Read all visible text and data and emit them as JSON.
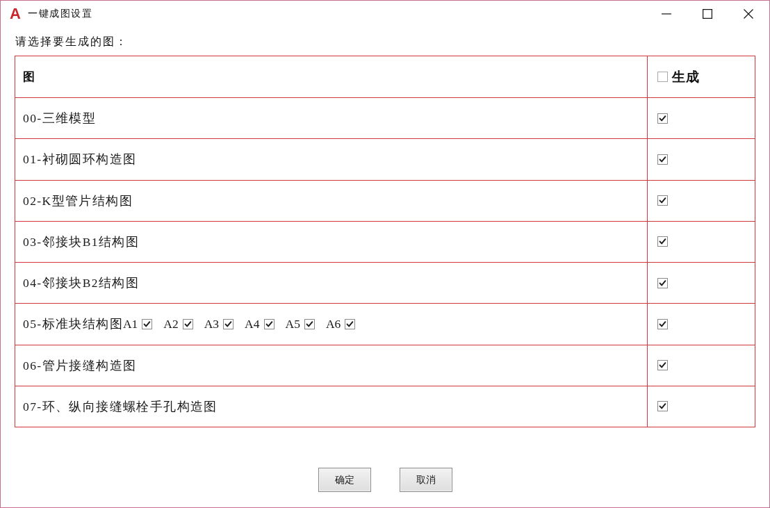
{
  "window": {
    "icon": "A",
    "title": "一键成图设置"
  },
  "prompt": "请选择要生成的图：",
  "table": {
    "columns": [
      {
        "label": "图",
        "kind": "text"
      },
      {
        "label": "生成",
        "kind": "checkbox",
        "checked": false
      }
    ],
    "rows": [
      {
        "title": "00-三维模型",
        "checked": true
      },
      {
        "title": "01-衬砌圆环构造图",
        "checked": true
      },
      {
        "title": "02-K型管片结构图",
        "checked": true
      },
      {
        "title": "03-邻接块B1结构图",
        "checked": true
      },
      {
        "title": "04-邻接块B2结构图",
        "checked": true
      },
      {
        "title": "05-标准块结构图",
        "options": [
          {
            "label": "A1",
            "checked": true
          },
          {
            "label": "A2",
            "checked": true
          },
          {
            "label": "A3",
            "checked": true
          },
          {
            "label": "A4",
            "checked": true
          },
          {
            "label": "A5",
            "checked": true
          },
          {
            "label": "A6",
            "checked": true
          }
        ],
        "checked": true
      },
      {
        "title": "06-管片接缝构造图",
        "checked": true
      },
      {
        "title": "07-环、纵向接缝螺栓手孔构造图",
        "checked": true
      }
    ]
  },
  "buttons": [
    {
      "label": "确定"
    },
    {
      "label": "取消"
    }
  ]
}
